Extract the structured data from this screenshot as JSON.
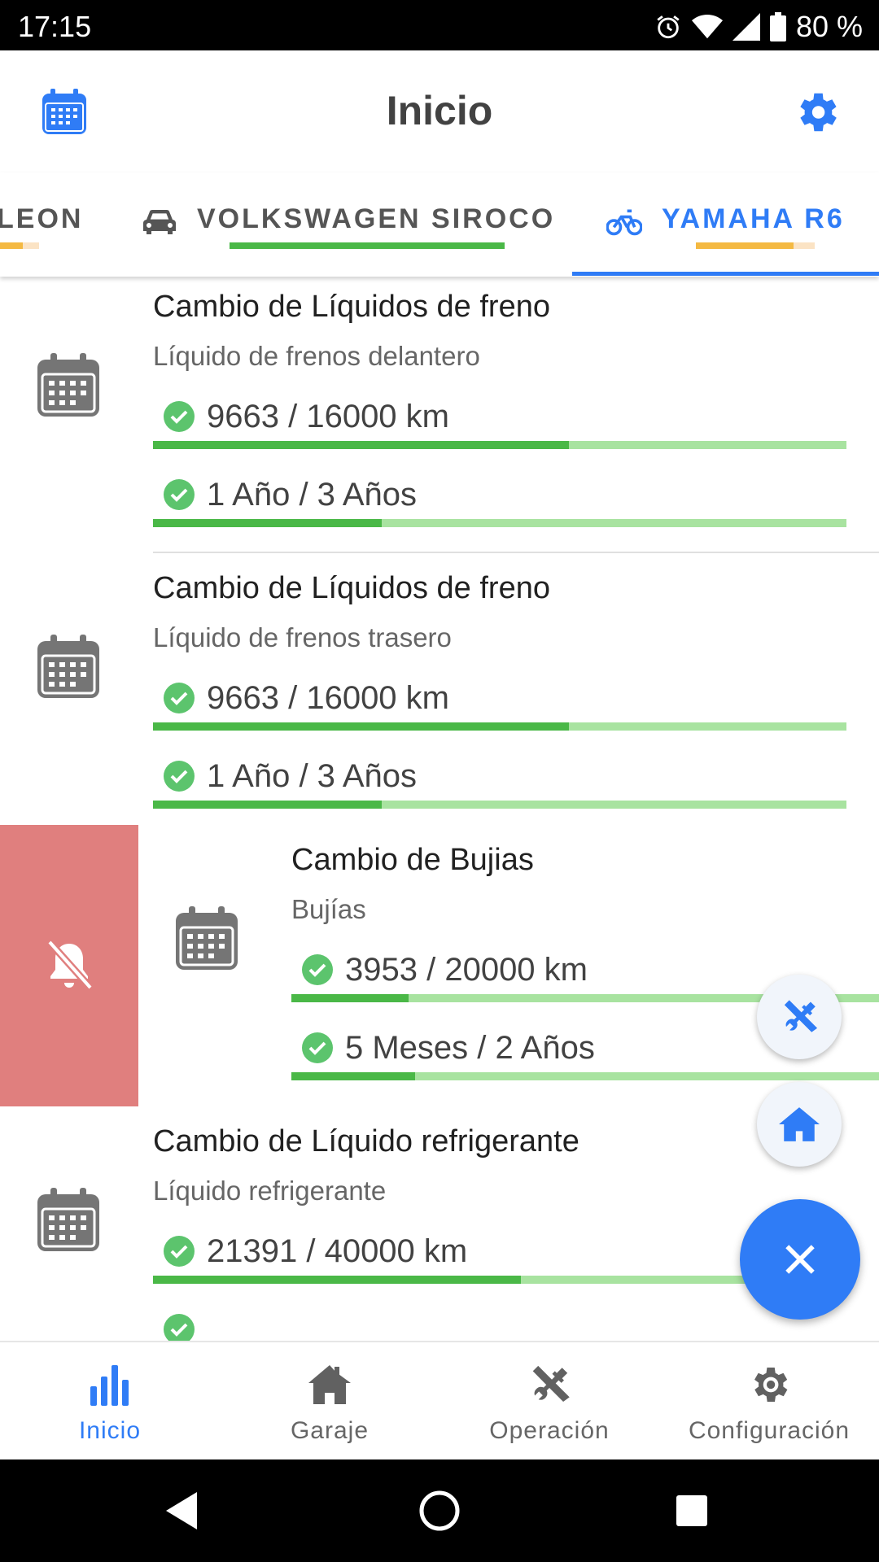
{
  "status_bar": {
    "time": "17:15",
    "battery": "80 %",
    "icons": [
      "alarm-icon",
      "wifi-icon",
      "signal-icon",
      "battery-icon"
    ]
  },
  "app_bar": {
    "title": "Inicio",
    "left_icon": "calendar-icon",
    "right_icon": "settings-icon"
  },
  "tabs": [
    {
      "label": "LEON",
      "icon": "",
      "selected": false
    },
    {
      "label": "VOLKSWAGEN SIROCO",
      "icon": "car-icon",
      "selected": false
    },
    {
      "label": "YAMAHA R6",
      "icon": "bicycle-icon",
      "selected": true
    }
  ],
  "items": [
    {
      "title": "Cambio de Líquidos de freno",
      "subtitle": "Líquido de frenos delantero",
      "metrics": [
        {
          "text": "9663 / 16000 km",
          "progress": 0.6
        },
        {
          "text": "1 Año / 3 Años",
          "progress": 0.33
        }
      ]
    },
    {
      "title": "Cambio de Líquidos de freno",
      "subtitle": "Líquido de frenos trasero",
      "metrics": [
        {
          "text": "9663 / 16000 km",
          "progress": 0.6
        },
        {
          "text": "1 Año / 3 Años",
          "progress": 0.33
        }
      ]
    },
    {
      "title": "Cambio de Bujias",
      "subtitle": "Bujías",
      "metrics": [
        {
          "text": "3953 / 20000 km",
          "progress": 0.2
        },
        {
          "text": "5 Meses / 2 Años",
          "progress": 0.21
        }
      ]
    },
    {
      "title": "Cambio de Líquido refrigerante",
      "subtitle": "Líquido refrigerante",
      "metrics": [
        {
          "text": "21391 / 40000 km",
          "progress": 0.53
        }
      ]
    }
  ],
  "swipe_action": {
    "icon": "bell-off-icon"
  },
  "fabs": {
    "operation_icon": "tools-icon",
    "garage_icon": "home-icon",
    "close_icon": "close-icon"
  },
  "bottom_nav": [
    {
      "label": "Inicio",
      "icon": "bar-chart-icon",
      "active": true
    },
    {
      "label": "Garaje",
      "icon": "garage-icon",
      "active": false
    },
    {
      "label": "Operación",
      "icon": "tools-icon",
      "active": false
    },
    {
      "label": "Configuración",
      "icon": "gear-icon",
      "active": false
    }
  ],
  "colors": {
    "accent": "#2f7cf6",
    "progress_fill": "#4ab847",
    "progress_track": "#a8e3a0",
    "check": "#5cc46d",
    "swipe_bg": "#e07f7e",
    "tab_yellow": "#f4b942",
    "tab_green": "#4ab847"
  }
}
